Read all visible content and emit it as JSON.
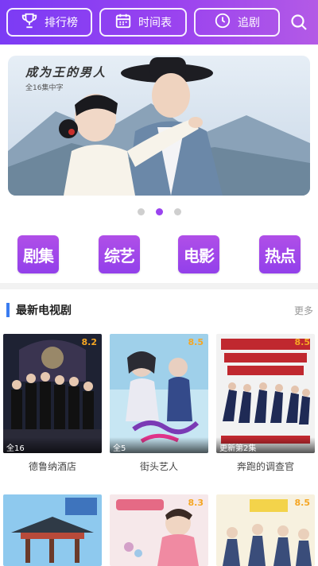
{
  "header": {
    "nav": [
      {
        "label": "排行榜",
        "icon": "trophy-icon"
      },
      {
        "label": "时间表",
        "icon": "calendar-icon"
      },
      {
        "label": "追剧",
        "icon": "clock-icon"
      }
    ],
    "search_icon": "search-icon",
    "gradient_start": "#7b3bf5",
    "gradient_end": "#b35ae6"
  },
  "banner": {
    "title": "成为王的男人",
    "subtitle": "全16集中字",
    "dots_count": 3,
    "active_dot": 2
  },
  "categories": [
    {
      "label": "剧集"
    },
    {
      "label": "综艺"
    },
    {
      "label": "电影"
    },
    {
      "label": "热点"
    }
  ],
  "section": {
    "title": "最新电视剧",
    "more_label": "更多",
    "accent": "#3a7cf0",
    "items": [
      {
        "name": "德鲁纳酒店",
        "episodes": "全16",
        "score": "8.2"
      },
      {
        "name": "街头艺人",
        "episodes": "全5",
        "score": "8.5"
      },
      {
        "name": "奔跑的调查官",
        "episodes": "更新第2集",
        "score": "8.5"
      },
      {
        "name": "",
        "episodes": "",
        "score": ""
      },
      {
        "name": "",
        "episodes": "",
        "score": "8.3"
      },
      {
        "name": "",
        "episodes": "",
        "score": "8.5"
      }
    ]
  }
}
